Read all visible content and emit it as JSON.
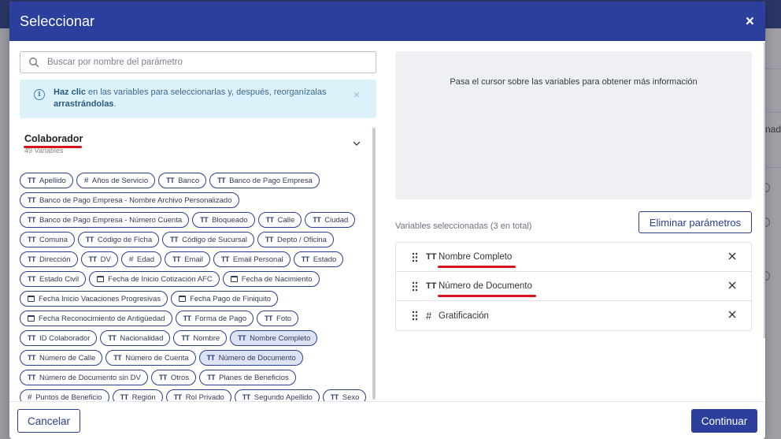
{
  "modal": {
    "title": "Seleccionar",
    "close_label": "×"
  },
  "background": {
    "right_fragment": "nado"
  },
  "search": {
    "placeholder": "Buscar por nombre del parámetro"
  },
  "info": {
    "bold1": "Haz clic",
    "text1": " en las variables para seleccionarlas y, después, reorganízalas ",
    "bold2": "arrastrándolas",
    "text2": ".",
    "close_label": "×"
  },
  "group": {
    "title": "Colaborador",
    "count": "49 Variables"
  },
  "chip_rows": [
    [
      {
        "t": "text",
        "l": "Apellido"
      },
      {
        "t": "number",
        "l": "Años de Servicio"
      },
      {
        "t": "text",
        "l": "Banco"
      },
      {
        "t": "text",
        "l": "Banco de Pago Empresa"
      }
    ],
    [
      {
        "t": "text",
        "l": "Banco de Pago Empresa - Nombre Archivo Personalizado"
      }
    ],
    [
      {
        "t": "text",
        "l": "Banco de Pago Empresa - Número Cuenta"
      },
      {
        "t": "text",
        "l": "Bloqueado"
      },
      {
        "t": "text",
        "l": "Calle"
      },
      {
        "t": "text",
        "l": "Ciudad"
      }
    ],
    [
      {
        "t": "text",
        "l": "Comuna"
      },
      {
        "t": "text",
        "l": "Código de Ficha"
      },
      {
        "t": "text",
        "l": "Código de Sucursal"
      },
      {
        "t": "text",
        "l": "Depto / Oficina"
      }
    ],
    [
      {
        "t": "text",
        "l": "Dirección"
      },
      {
        "t": "text",
        "l": "DV"
      },
      {
        "t": "number",
        "l": "Edad"
      },
      {
        "t": "text",
        "l": "Email"
      },
      {
        "t": "text",
        "l": "Email Personal"
      },
      {
        "t": "text",
        "l": "Estado"
      }
    ],
    [
      {
        "t": "text",
        "l": "Estado Civil"
      },
      {
        "t": "date",
        "l": "Fecha de Inicio Cotización AFC"
      },
      {
        "t": "date",
        "l": "Fecha de Nacimiento"
      }
    ],
    [
      {
        "t": "date",
        "l": "Fecha Inicio Vacaciones Progresivas"
      },
      {
        "t": "date",
        "l": "Fecha Pago de Finiquito"
      }
    ],
    [
      {
        "t": "date",
        "l": "Fecha Reconocimiento de Antigüedad"
      },
      {
        "t": "text",
        "l": "Forma de Pago"
      },
      {
        "t": "text",
        "l": "Foto"
      }
    ],
    [
      {
        "t": "text",
        "l": "ID Colaborador"
      },
      {
        "t": "text",
        "l": "Nacionalidad"
      },
      {
        "t": "text",
        "l": "Nombre"
      },
      {
        "t": "text",
        "l": "Nombre Completo",
        "sel": true
      }
    ],
    [
      {
        "t": "text",
        "l": "Número de Calle"
      },
      {
        "t": "text",
        "l": "Número de Cuenta"
      },
      {
        "t": "text",
        "l": "Número de Documento",
        "sel": true
      }
    ],
    [
      {
        "t": "text",
        "l": "Número de Documento sin DV"
      },
      {
        "t": "text",
        "l": "Otros"
      },
      {
        "t": "text",
        "l": "Planes de Beneficios"
      }
    ],
    [
      {
        "t": "number",
        "l": "Puntos de Beneficio"
      },
      {
        "t": "text",
        "l": "Región"
      },
      {
        "t": "text",
        "l": "Rol Privado"
      },
      {
        "t": "text",
        "l": "Segundo Apellido"
      },
      {
        "t": "text",
        "l": "Sexo"
      }
    ]
  ],
  "type_glyphs": {
    "text": "TT",
    "number": "#"
  },
  "hover": {
    "text": "Pasa el cursor sobre las variables para obtener más información"
  },
  "selected": {
    "label": "Variables seleccionadas (3 en total)",
    "clear_button": "Eliminar parámetros",
    "items": [
      {
        "type": "TT",
        "name": "Nombre Completo",
        "underline": true
      },
      {
        "type": "TT",
        "name": "Número de Documento",
        "underline": true
      },
      {
        "type": "#",
        "name": "Gratificación",
        "underline": false
      }
    ]
  },
  "footer": {
    "cancel": "Cancelar",
    "continue": "Continuar"
  },
  "colors": {
    "primary": "#2c3f9c",
    "annotation_red": "#d4141c",
    "info_bg": "#ddf1fb",
    "chip_selected_bg": "#dde3f7"
  }
}
